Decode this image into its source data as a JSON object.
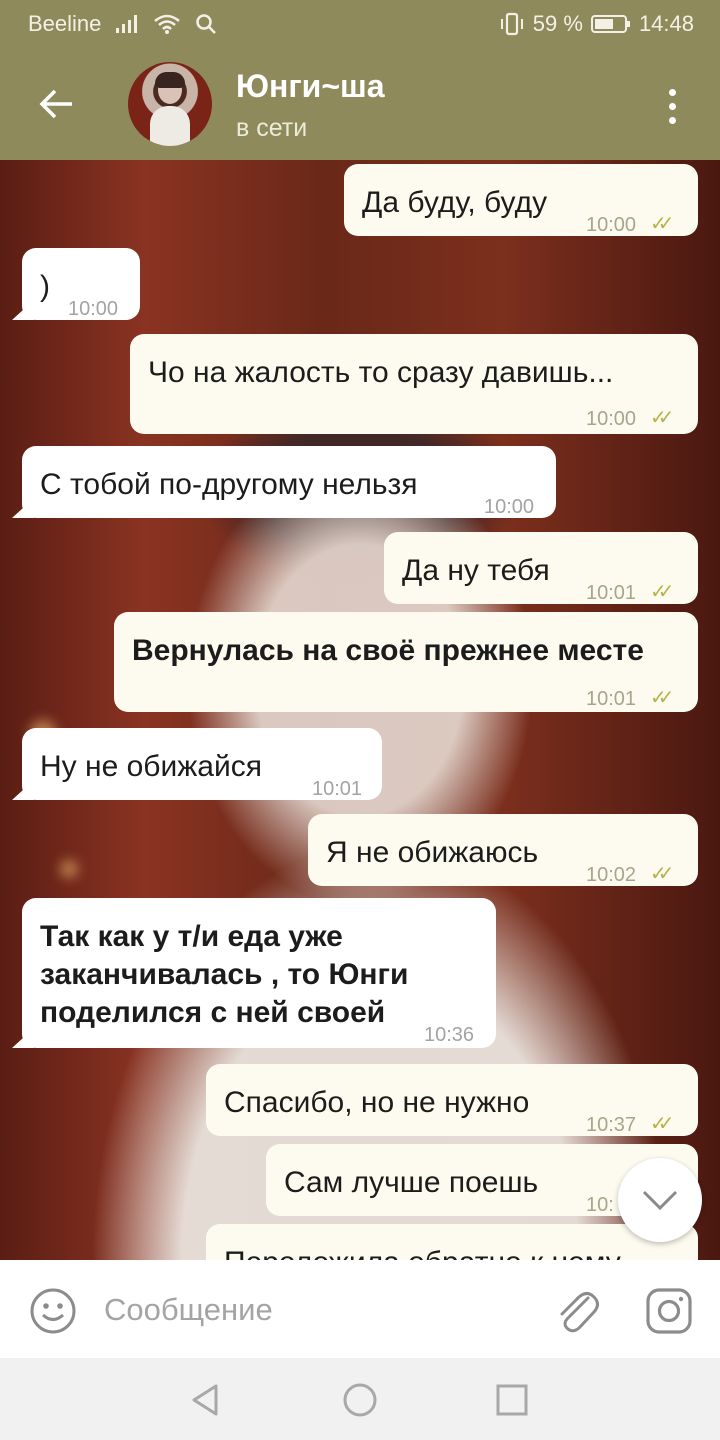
{
  "status_bar": {
    "carrier": "Beeline",
    "battery": "59 %",
    "time": "14:48"
  },
  "header": {
    "title": "Юнги~ша",
    "status": "в сети"
  },
  "messages": [
    {
      "dir": "out",
      "text": "Да буду, буду",
      "time": "10:00",
      "read": true
    },
    {
      "dir": "in",
      "text": ")",
      "time": "10:00"
    },
    {
      "dir": "out",
      "text": "Чо на жалость то сразу давишь...",
      "time": "10:00",
      "read": true
    },
    {
      "dir": "in",
      "text": "С тобой по-другому нельзя",
      "time": "10:00"
    },
    {
      "dir": "out",
      "text": "Да ну тебя",
      "time": "10:01",
      "read": true
    },
    {
      "dir": "out",
      "text": "Вернулась на своё прежнее месте",
      "time": "10:01",
      "read": true
    },
    {
      "dir": "in",
      "text": "Ну не обижайся",
      "time": "10:01"
    },
    {
      "dir": "out",
      "text": "Я не обижаюсь",
      "time": "10:02",
      "read": true
    },
    {
      "dir": "in",
      "text": "Так как у т/и еда уже\nзаканчивалась , то Юнги\nподелился с ней своей",
      "time": "10:36"
    },
    {
      "dir": "out",
      "text": "Спасибо, но не нужно",
      "time": "10:37",
      "read": true
    },
    {
      "dir": "out",
      "text": "Сам лучше поешь",
      "time": "10:"
    },
    {
      "dir": "out",
      "text": "Переложила обратно к нему"
    }
  ],
  "composer": {
    "placeholder": "Сообщение"
  },
  "icons": {
    "back": "arrow-left-icon",
    "menu": "more-vertical-icon",
    "scroll": "chevron-down-icon",
    "emoji": "smiley-icon",
    "attach": "paperclip-icon",
    "camera": "instagram-camera-icon"
  },
  "colors": {
    "header": "#8f8a5c",
    "outgoing_bubble": "#fdfbef",
    "incoming_bubble": "#ffffff",
    "read_check": "#b8b24d"
  }
}
